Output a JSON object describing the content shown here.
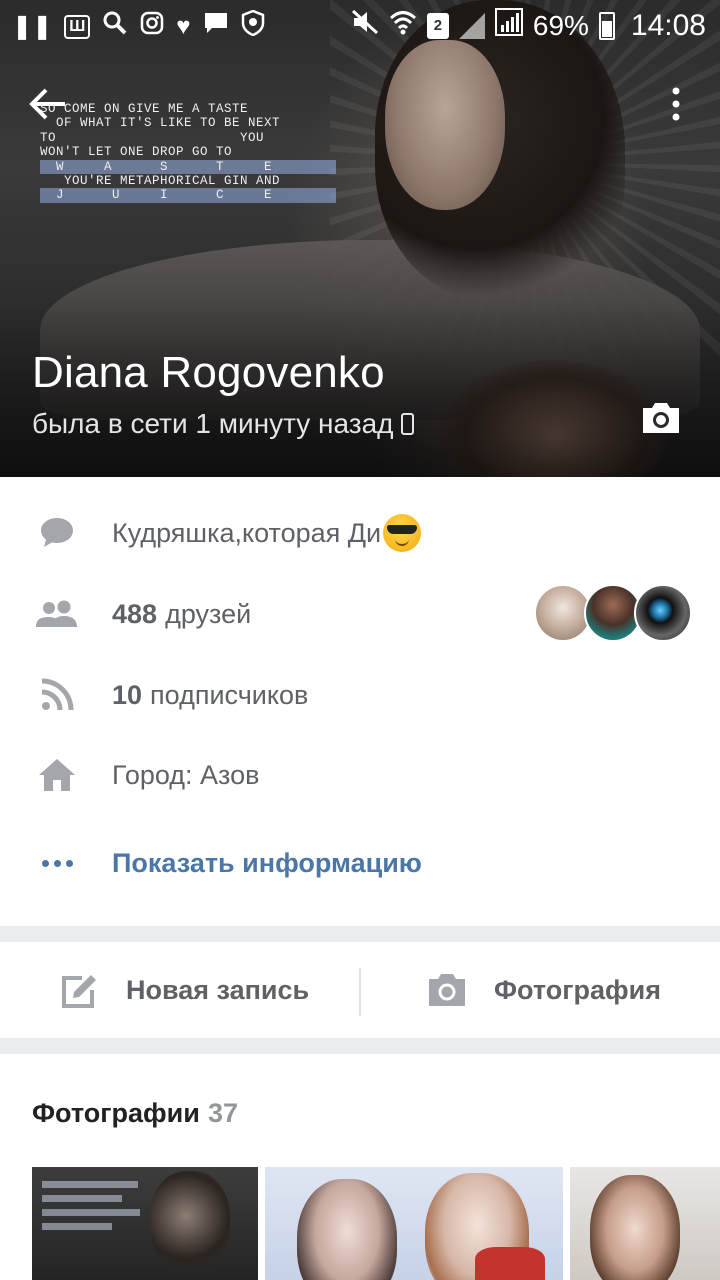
{
  "status_bar": {
    "battery": "69%",
    "time": "14:08",
    "sim_slot": "2",
    "left_icons": [
      "pause-icon",
      "app-w-icon",
      "search-icon",
      "instagram-icon",
      "heart-icon",
      "chat-icon",
      "shield-icon"
    ],
    "right_icons": [
      "mute-icon",
      "wifi-icon",
      "sim-icon",
      "signal-icon",
      "battery-icon"
    ]
  },
  "header": {
    "name": "Diana Rogovenko",
    "online_status": "была в сети 1 минуту назад",
    "cover_lyrics": [
      "SO COME ON GIVE ME A TASTE",
      "  OF WHAT IT'S LIKE TO BE NEXT",
      "TO                       YOU",
      "WON'T LET ONE DROP GO TO",
      "  W     A      S      T     E",
      "   YOU'RE METAPHORICAL GIN AND",
      "  J      U     I      C     E"
    ]
  },
  "info": {
    "status_text": "Кудряшка,которая Ди",
    "friends_count": "488",
    "friends_label": "друзей",
    "followers_count": "10",
    "followers_label": "подписчиков",
    "city": "Город: Азов",
    "show_info": "Показать информацию"
  },
  "actions": {
    "new_post": "Новая запись",
    "photo": "Фотография"
  },
  "photos": {
    "title": "Фотографии",
    "count": "37"
  },
  "colors": {
    "link": "#4a76a8",
    "icon_gray": "#a3a6ab",
    "text_gray": "#5e6166",
    "background": "#ebedf0"
  }
}
